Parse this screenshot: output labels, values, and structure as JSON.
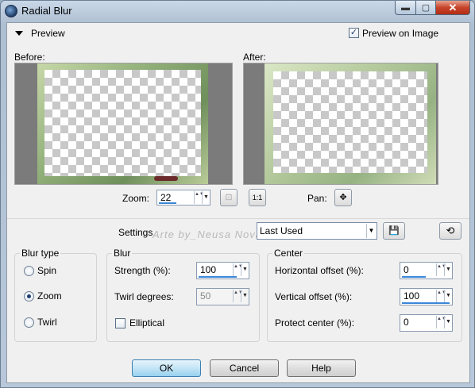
{
  "window": {
    "title": "Radial Blur",
    "min_glyph": "▬",
    "max_glyph": "▢",
    "close_glyph": "✕"
  },
  "preview": {
    "label": "Preview",
    "preview_on_image_label": "Preview on Image",
    "preview_on_image_checked": true,
    "checkmark": "✓",
    "before_label": "Before:",
    "after_label": "After:",
    "zoom_label": "Zoom:",
    "zoom_value": "22",
    "pan_label": "Pan:",
    "fit_glyph": "⊡",
    "actual_size_glyph": "1:1",
    "pan_glyph": "✥"
  },
  "settings": {
    "label": "Settings",
    "preset_value": "Last Used",
    "watermark": "Arte by_Neusa Novaes",
    "save_glyph": "💾",
    "reset_glyph": "⟲"
  },
  "blur_type": {
    "title": "Blur type",
    "options": [
      {
        "label": "Spin",
        "selected": false
      },
      {
        "label": "Zoom",
        "selected": true
      },
      {
        "label": "Twirl",
        "selected": false
      }
    ]
  },
  "blur": {
    "title": "Blur",
    "strength_label": "Strength (%):",
    "strength_value": "100",
    "twirl_label": "Twirl degrees:",
    "twirl_value": "50",
    "elliptical_label": "Elliptical",
    "elliptical_checked": false
  },
  "center": {
    "title": "Center",
    "h_offset_label": "Horizontal offset (%):",
    "h_offset_value": "0",
    "v_offset_label": "Vertical offset (%):",
    "v_offset_value": "100",
    "protect_label": "Protect center (%):",
    "protect_value": "0"
  },
  "buttons": {
    "ok": "OK",
    "cancel": "Cancel",
    "help": "Help"
  },
  "spin_arrows": "▲▼",
  "dropdown_glyph": "▼"
}
